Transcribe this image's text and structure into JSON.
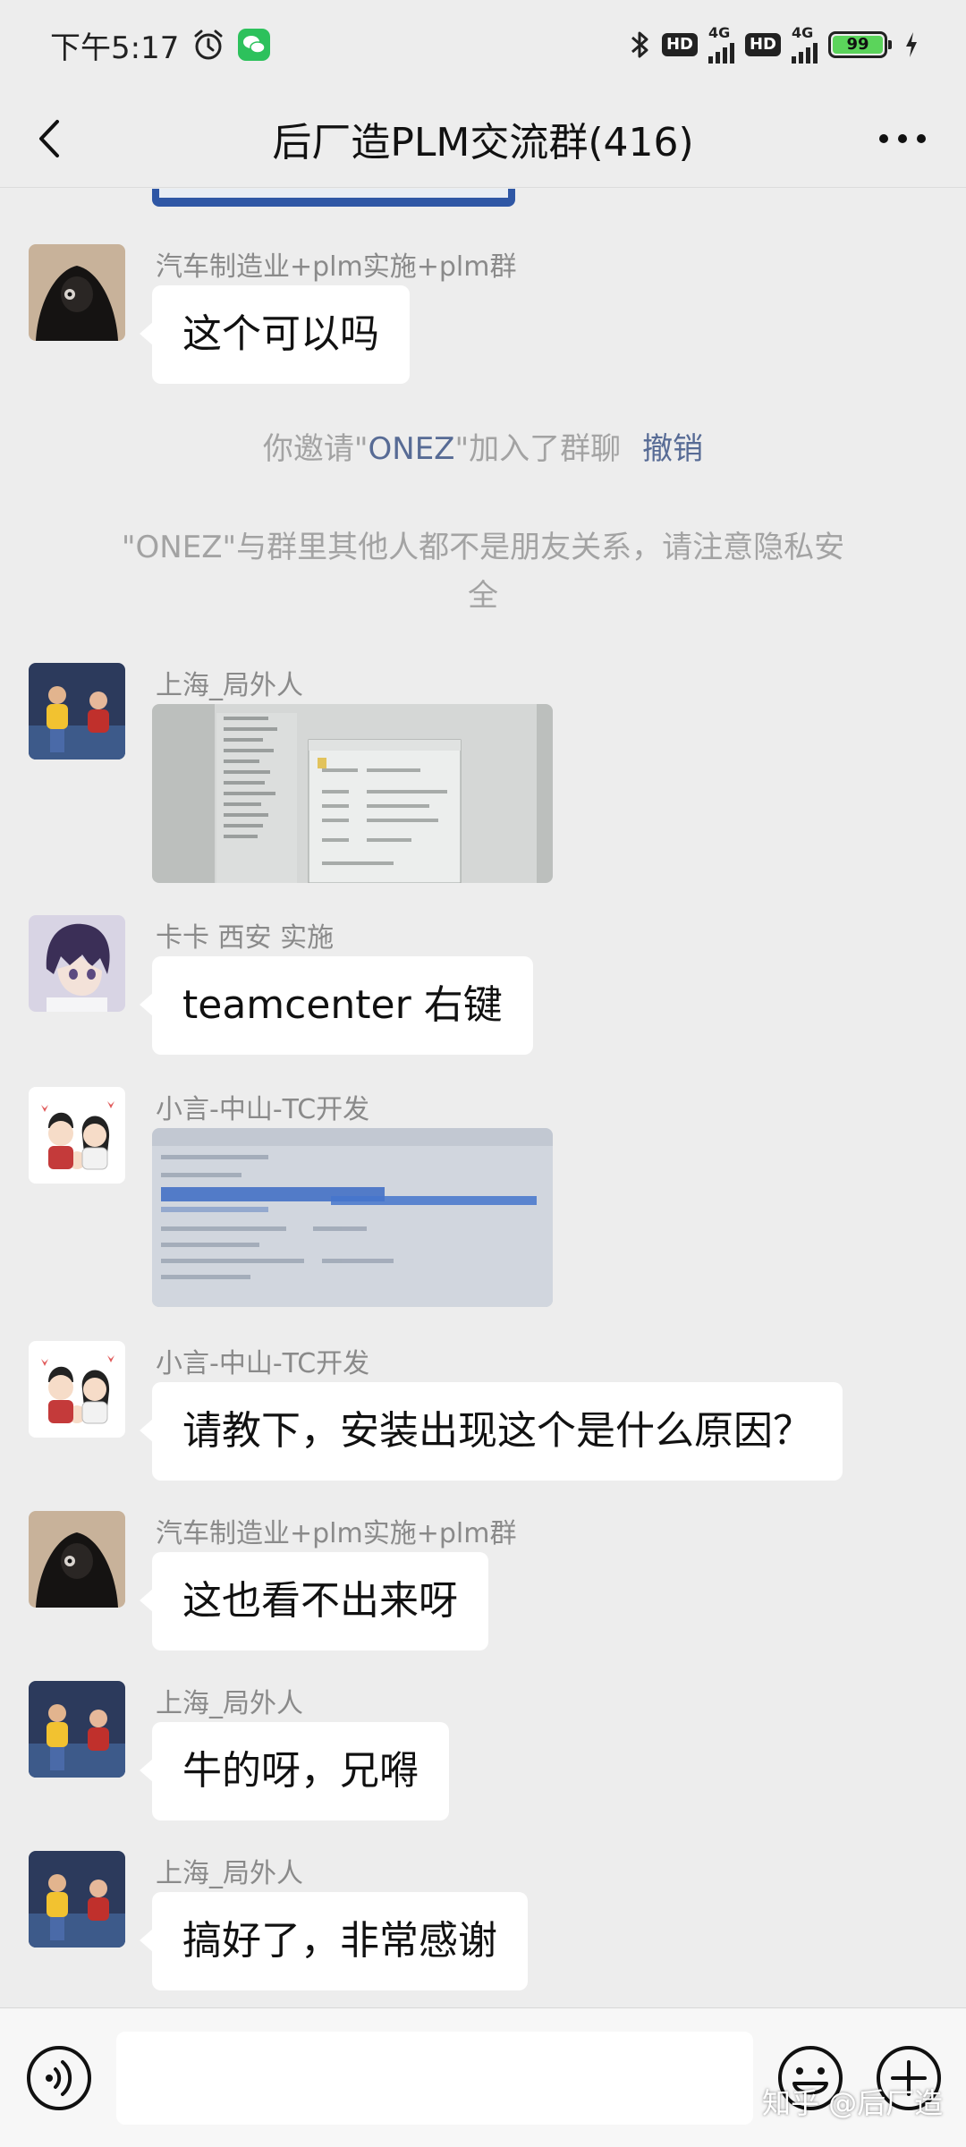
{
  "status_bar": {
    "time": "下午5:17",
    "network_type": "4G",
    "hd_label": "HD",
    "battery_level": "99",
    "icons": [
      "alarm-icon",
      "wechat-icon",
      "bluetooth-icon",
      "signal-icon",
      "battery-icon",
      "charging-icon"
    ]
  },
  "header": {
    "title": "后厂造PLM交流群(416)",
    "back_icon": "chevron-left-icon",
    "more_icon": "more-dots-icon"
  },
  "system_notices": {
    "invite_prefix": "你邀请\"",
    "invite_name": "ONEZ",
    "invite_suffix": "\"加入了群聊",
    "invite_action": "撤销",
    "privacy_line1": "\"ONEZ\"与群里其他人都不是朋友关系，请注意隐私安",
    "privacy_line2": "全"
  },
  "messages": [
    {
      "sender": "汽车制造业+plm实施+plm群",
      "text": "这个可以吗",
      "avatar": "hooded-figure-avatar"
    },
    {
      "sender": "上海_局外人",
      "type": "image",
      "image_desc": "file-properties-dialog-photo",
      "avatar": "two-kids-avatar"
    },
    {
      "sender": "卡卡 西安 实施",
      "text": "teamcenter 右键",
      "avatar": "anime-boy-avatar"
    },
    {
      "sender": "小言-中山-TC开发",
      "type": "image",
      "image_desc": "blurry-screen-photo",
      "avatar": "cartoon-couple-avatar"
    },
    {
      "sender": "小言-中山-TC开发",
      "text": "请教下，安装出现这个是什么原因？",
      "avatar": "cartoon-couple-avatar"
    },
    {
      "sender": "汽车制造业+plm实施+plm群",
      "text": "这也看不出来呀",
      "avatar": "hooded-figure-avatar"
    },
    {
      "sender": "上海_局外人",
      "text": "牛的呀，兄嘚",
      "avatar": "two-kids-avatar"
    },
    {
      "sender": "上海_局外人",
      "text": "搞好了，非常感谢",
      "avatar": "two-kids-avatar"
    }
  ],
  "input_bar": {
    "placeholder": "",
    "voice_icon": "voice-icon",
    "emoji_icon": "emoji-icon",
    "plus_icon": "plus-icon"
  },
  "watermark": "知乎 @后厂造",
  "colors": {
    "background": "#ededed",
    "bubble": "#ffffff",
    "link": "#576b95",
    "system_text": "#a3a3a3",
    "sender_text": "#8a8a8a",
    "battery": "#5bd45b"
  }
}
